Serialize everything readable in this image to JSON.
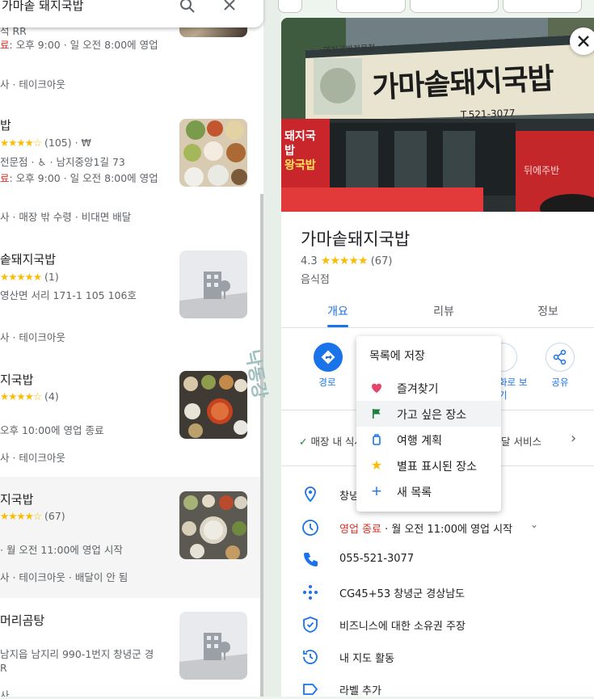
{
  "search": {
    "query": "가마솥 돼지국밥",
    "search_icon": "search-icon",
    "clear_icon": "close-icon"
  },
  "results": [
    {
      "name": "",
      "line1": "",
      "hours_prefix": "료",
      "hours": ": 오후 9:00 · 일 오전 8:00에 영업",
      "services": "사 · 테이크아웃",
      "extra": "석 RR"
    },
    {
      "name": "밥",
      "rating_suffix": "(105) · ₩",
      "address": "전문점 · ♿ · 남지중앙1길 73",
      "hours_prefix": "료",
      "hours": ": 오후 9:00 · 일 오전 8:00에 영업",
      "services": "사 · 매장 밖 수령 · 비대면 배달"
    },
    {
      "name": "솥돼지국밥",
      "rating_suffix": "(1)",
      "address": "영산면 서리 171-1 105 106호",
      "services": "사 · 테이크아웃"
    },
    {
      "name": "지국밥",
      "rating_suffix": "(4)",
      "hours": "오후 10:00에 영업 종료",
      "services": "사 · 테이크아웃"
    },
    {
      "name": "지국밥",
      "rating_suffix": "(67)",
      "hours": " · 월 오전 11:00에 영업 시작",
      "services": "사 · 테이크아웃 · 배달이 안 됨"
    },
    {
      "name": "머리곰탕",
      "address": "남지읍 남지리 990-1번지 창녕군 경",
      "address2": "R",
      "services": "사"
    }
  ],
  "map_label": "낙동강",
  "place": {
    "name": "가마솥돼지국밥",
    "rating": "4.3",
    "review_count": "(67)",
    "rating_stars": 4.3,
    "category": "음식점",
    "sign_main": "가마솥돼지국밥",
    "sign_top": "돼지국밥전문점",
    "sign_phone": "T.521-3077",
    "banner_left": "돼지국밥",
    "banner_left2": "왕국밥",
    "banner_right": "뒤에주반"
  },
  "tabs": [
    "개요",
    "리뷰",
    "정보"
  ],
  "actions": {
    "route": "경로",
    "share": "공유",
    "partial_label1": "화로 보",
    "partial_label2": "기"
  },
  "service_row": {
    "left": "매장 내 식사",
    "right": "달 서비스"
  },
  "info": {
    "address": "창녕",
    "hours_status": "영업 종료",
    "hours_rest": " · 월 오전 11:00에 영업 시작",
    "phone": "055-521-3077",
    "plus_code": "CG45+53 창녕군 경상남도",
    "claim": "비즈니스에 대한 소유권 주장",
    "activity": "내 지도 활동",
    "label": "라벨 추가"
  },
  "save_menu": {
    "title": "목록에 저장",
    "items": [
      {
        "label": "즐겨찾기",
        "icon": "heart-icon",
        "color": "#e8436b"
      },
      {
        "label": "가고 싶은 장소",
        "icon": "flag-icon",
        "color": "#188038"
      },
      {
        "label": "여행 계획",
        "icon": "suitcase-icon",
        "color": "#1a73e8"
      },
      {
        "label": "별표 표시된 장소",
        "icon": "star-icon",
        "color": "#fbbc04"
      },
      {
        "label": "새 목록",
        "icon": "plus-icon",
        "color": "#1a73e8"
      }
    ]
  },
  "colors": {
    "accent": "#1a73e8",
    "closed": "#d93025",
    "star": "#fbbc04"
  }
}
